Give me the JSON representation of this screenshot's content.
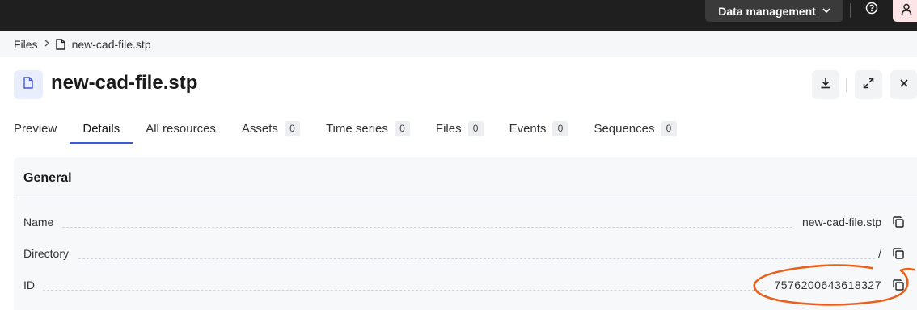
{
  "topbar": {
    "menu_label": "Data management",
    "icons": {
      "menu_chevron": "chevron-down-icon",
      "help": "help-circle-icon",
      "user": "user-icon"
    }
  },
  "breadcrumb": {
    "root": "Files",
    "current": "new-cad-file.stp"
  },
  "header": {
    "title": "new-cad-file.stp",
    "actions": [
      "download-icon",
      "expand-icon",
      "close-icon"
    ]
  },
  "tabs": [
    {
      "label": "Preview"
    },
    {
      "label": "Details",
      "active": true
    },
    {
      "label": "All resources"
    },
    {
      "label": "Assets",
      "count": "0"
    },
    {
      "label": "Time series",
      "count": "0"
    },
    {
      "label": "Files",
      "count": "0"
    },
    {
      "label": "Events",
      "count": "0"
    },
    {
      "label": "Sequences",
      "count": "0"
    }
  ],
  "general": {
    "title": "General",
    "rows": [
      {
        "label": "Name",
        "value": "new-cad-file.stp"
      },
      {
        "label": "Directory",
        "value": "/"
      },
      {
        "label": "ID",
        "value": "7576200643618327"
      }
    ]
  },
  "colors": {
    "topbar": "#1f1f1f",
    "accent": "#3d5ad6",
    "annotation": "#e8601c",
    "user_bg": "#fde5e7"
  }
}
